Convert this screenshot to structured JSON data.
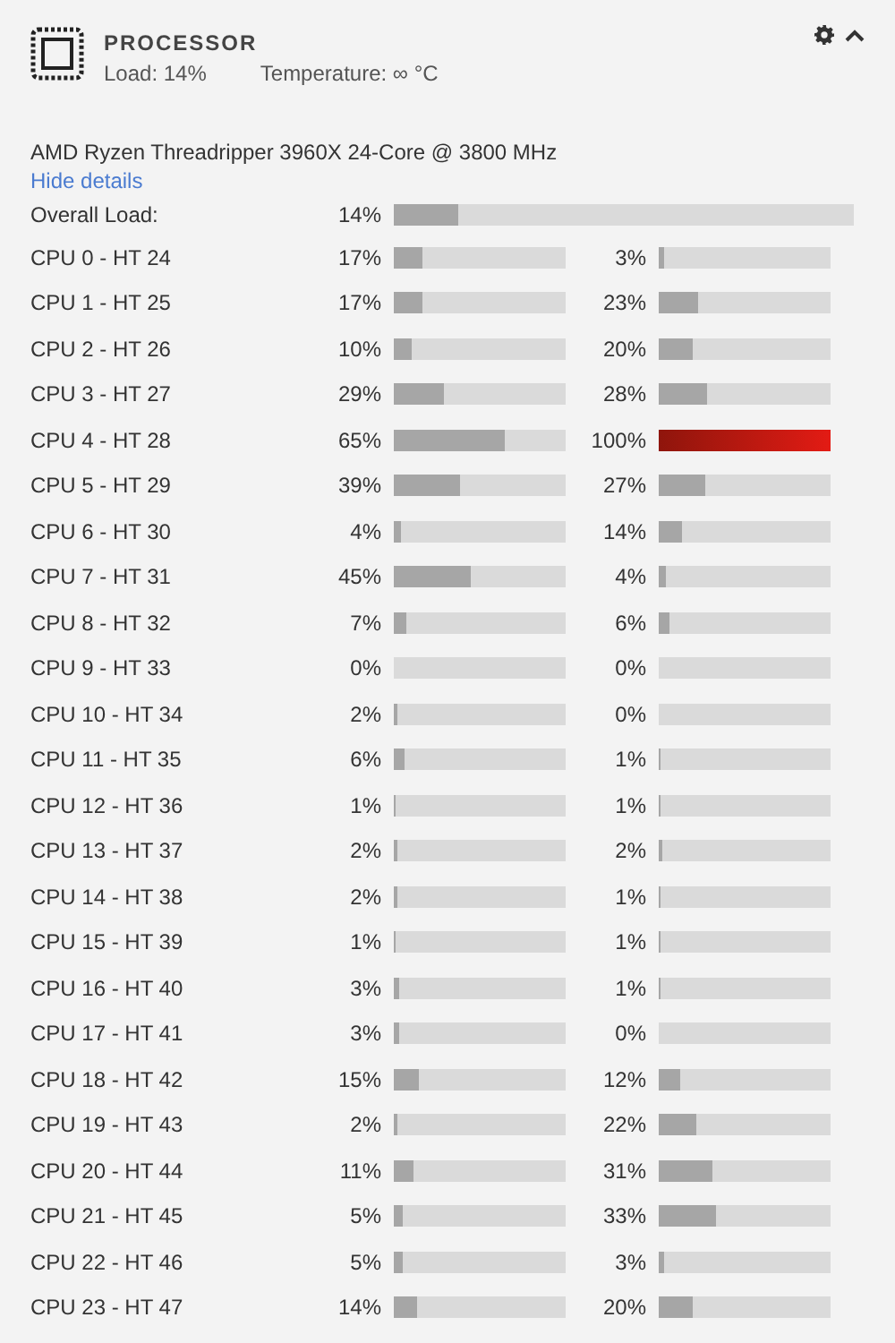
{
  "header": {
    "title": "PROCESSOR",
    "load": "Load: 14%",
    "temperature": "Temperature: ∞ °C"
  },
  "model": "AMD Ryzen Threadripper 3960X 24-Core @ 3800 MHz",
  "details_link": "Hide details",
  "overall": {
    "label": "Overall Load:",
    "reading": "14%",
    "level": 0.14
  },
  "cores": [
    {
      "label": "CPU 0 - HT 24",
      "threads": [
        {
          "reading": "17%",
          "level": 0.17
        },
        {
          "reading": "3%",
          "level": 0.03
        }
      ]
    },
    {
      "label": "CPU 1 - HT 25",
      "threads": [
        {
          "reading": "17%",
          "level": 0.17
        },
        {
          "reading": "23%",
          "level": 0.23
        }
      ]
    },
    {
      "label": "CPU 2 - HT 26",
      "threads": [
        {
          "reading": "10%",
          "level": 0.1
        },
        {
          "reading": "20%",
          "level": 0.2
        }
      ]
    },
    {
      "label": "CPU 3 - HT 27",
      "threads": [
        {
          "reading": "29%",
          "level": 0.29
        },
        {
          "reading": "28%",
          "level": 0.28
        }
      ]
    },
    {
      "label": "CPU 4 - HT 28",
      "threads": [
        {
          "reading": "65%",
          "level": 0.65
        },
        {
          "reading": "100%",
          "level": 1
        }
      ]
    },
    {
      "label": "CPU 5 - HT 29",
      "threads": [
        {
          "reading": "39%",
          "level": 0.39
        },
        {
          "reading": "27%",
          "level": 0.27
        }
      ]
    },
    {
      "label": "CPU 6 - HT 30",
      "threads": [
        {
          "reading": "4%",
          "level": 0.04
        },
        {
          "reading": "14%",
          "level": 0.14
        }
      ]
    },
    {
      "label": "CPU 7 - HT 31",
      "threads": [
        {
          "reading": "45%",
          "level": 0.45
        },
        {
          "reading": "4%",
          "level": 0.04
        }
      ]
    },
    {
      "label": "CPU 8 - HT 32",
      "threads": [
        {
          "reading": "7%",
          "level": 0.07
        },
        {
          "reading": "6%",
          "level": 0.06
        }
      ]
    },
    {
      "label": "CPU 9 - HT 33",
      "threads": [
        {
          "reading": "0%",
          "level": 0
        },
        {
          "reading": "0%",
          "level": 0
        }
      ]
    },
    {
      "label": "CPU 10 - HT 34",
      "threads": [
        {
          "reading": "2%",
          "level": 0.02
        },
        {
          "reading": "0%",
          "level": 0
        }
      ]
    },
    {
      "label": "CPU 11 - HT 35",
      "threads": [
        {
          "reading": "6%",
          "level": 0.06
        },
        {
          "reading": "1%",
          "level": 0.01
        }
      ]
    },
    {
      "label": "CPU 12 - HT 36",
      "threads": [
        {
          "reading": "1%",
          "level": 0.01
        },
        {
          "reading": "1%",
          "level": 0.01
        }
      ]
    },
    {
      "label": "CPU 13 - HT 37",
      "threads": [
        {
          "reading": "2%",
          "level": 0.02
        },
        {
          "reading": "2%",
          "level": 0.02
        }
      ]
    },
    {
      "label": "CPU 14 - HT 38",
      "threads": [
        {
          "reading": "2%",
          "level": 0.02
        },
        {
          "reading": "1%",
          "level": 0.01
        }
      ]
    },
    {
      "label": "CPU 15 - HT 39",
      "threads": [
        {
          "reading": "1%",
          "level": 0.01
        },
        {
          "reading": "1%",
          "level": 0.01
        }
      ]
    },
    {
      "label": "CPU 16 - HT 40",
      "threads": [
        {
          "reading": "3%",
          "level": 0.03
        },
        {
          "reading": "1%",
          "level": 0.01
        }
      ]
    },
    {
      "label": "CPU 17 - HT 41",
      "threads": [
        {
          "reading": "3%",
          "level": 0.03
        },
        {
          "reading": "0%",
          "level": 0
        }
      ]
    },
    {
      "label": "CPU 18 - HT 42",
      "threads": [
        {
          "reading": "15%",
          "level": 0.15
        },
        {
          "reading": "12%",
          "level": 0.12
        }
      ]
    },
    {
      "label": "CPU 19 - HT 43",
      "threads": [
        {
          "reading": "2%",
          "level": 0.02
        },
        {
          "reading": "22%",
          "level": 0.22
        }
      ]
    },
    {
      "label": "CPU 20 - HT 44",
      "threads": [
        {
          "reading": "11%",
          "level": 0.11
        },
        {
          "reading": "31%",
          "level": 0.31
        }
      ]
    },
    {
      "label": "CPU 21 - HT 45",
      "threads": [
        {
          "reading": "5%",
          "level": 0.05
        },
        {
          "reading": "33%",
          "level": 0.33
        }
      ]
    },
    {
      "label": "CPU 22 - HT 46",
      "threads": [
        {
          "reading": "5%",
          "level": 0.05
        },
        {
          "reading": "3%",
          "level": 0.03
        }
      ]
    },
    {
      "label": "CPU 23 - HT 47",
      "threads": [
        {
          "reading": "14%",
          "level": 0.14
        },
        {
          "reading": "20%",
          "level": 0.2
        }
      ]
    }
  ]
}
